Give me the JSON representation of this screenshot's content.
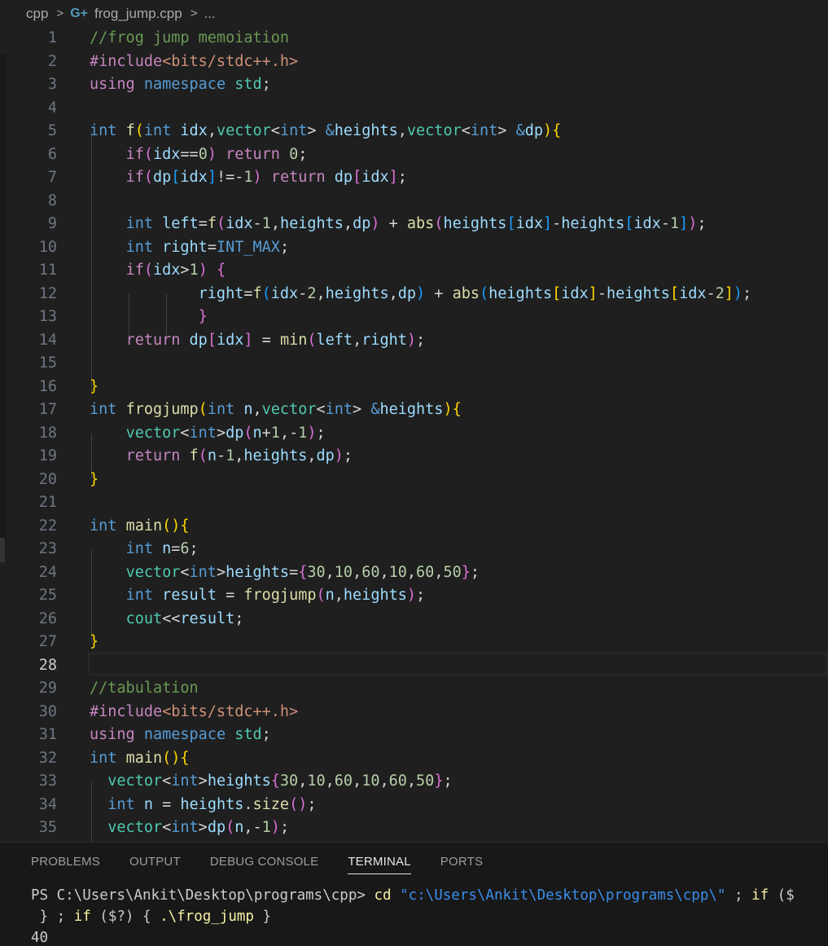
{
  "breadcrumb": {
    "folder": "cpp",
    "file": "frog_jump.cpp",
    "more": "..."
  },
  "editor": {
    "active_line": "28",
    "lines": [
      {
        "n": "1",
        "html": "<span class='cm'>//frog jump memoiation</span>"
      },
      {
        "n": "2",
        "html": "<span class='c'>#include</span><span class='s'>&lt;bits/stdc++.h&gt;</span>"
      },
      {
        "n": "3",
        "html": "<span class='c'>using</span> <span class='k'>namespace</span> <span class='t'>std</span><span class='p'>;</span>"
      },
      {
        "n": "4",
        "html": ""
      },
      {
        "n": "5",
        "html": "<span class='k'>int</span> <span class='f'>f</span><span class='b1'>(</span><span class='k'>int</span> <span class='v'>idx</span><span class='p'>,</span><span class='t'>vector</span><span class='p'>&lt;</span><span class='k'>int</span><span class='p'>&gt;</span> <span class='k'>&amp;</span><span class='v'>heights</span><span class='p'>,</span><span class='t'>vector</span><span class='p'>&lt;</span><span class='k'>int</span><span class='p'>&gt;</span> <span class='k'>&amp;</span><span class='v'>dp</span><span class='b1'>)</span><span class='b1'>{</span>"
      },
      {
        "n": "6",
        "html": "    <span class='c'>if</span><span class='b2'>(</span><span class='v'>idx</span><span class='p'>==</span><span class='n'>0</span><span class='b2'>)</span> <span class='c'>return</span> <span class='n'>0</span><span class='p'>;</span>"
      },
      {
        "n": "7",
        "html": "    <span class='c'>if</span><span class='b2'>(</span><span class='v'>dp</span><span class='b3'>[</span><span class='v'>idx</span><span class='b3'>]</span><span class='p'>!=-</span><span class='n'>1</span><span class='b2'>)</span> <span class='c'>return</span> <span class='v'>dp</span><span class='b2'>[</span><span class='v'>idx</span><span class='b2'>]</span><span class='p'>;</span>"
      },
      {
        "n": "8",
        "html": ""
      },
      {
        "n": "9",
        "html": "    <span class='k'>int</span> <span class='v'>left</span><span class='p'>=</span><span class='f'>f</span><span class='b2'>(</span><span class='v'>idx</span><span class='p'>-</span><span class='n'>1</span><span class='p'>,</span><span class='v'>heights</span><span class='p'>,</span><span class='v'>dp</span><span class='b2'>)</span> <span class='p'>+</span> <span class='f'>abs</span><span class='b2'>(</span><span class='v'>heights</span><span class='b3'>[</span><span class='v'>idx</span><span class='b3'>]</span><span class='p'>-</span><span class='v'>heights</span><span class='b3'>[</span><span class='v'>idx</span><span class='p'>-</span><span class='n'>1</span><span class='b3'>]</span><span class='b2'>)</span><span class='p'>;</span>"
      },
      {
        "n": "10",
        "html": "    <span class='k'>int</span> <span class='v'>right</span><span class='p'>=</span><span class='k'>INT_MAX</span><span class='p'>;</span>"
      },
      {
        "n": "11",
        "html": "    <span class='c'>if</span><span class='b2'>(</span><span class='v'>idx</span><span class='p'>&gt;</span><span class='n'>1</span><span class='b2'>)</span> <span class='b2'>{</span>"
      },
      {
        "n": "12",
        "html": "            <span class='v'>right</span><span class='p'>=</span><span class='f'>f</span><span class='b3'>(</span><span class='v'>idx</span><span class='p'>-</span><span class='n'>2</span><span class='p'>,</span><span class='v'>heights</span><span class='p'>,</span><span class='v'>dp</span><span class='b3'>)</span> <span class='p'>+</span> <span class='f'>abs</span><span class='b3'>(</span><span class='v'>heights</span><span class='b1'>[</span><span class='v'>idx</span><span class='b1'>]</span><span class='p'>-</span><span class='v'>heights</span><span class='b1'>[</span><span class='v'>idx</span><span class='p'>-</span><span class='n'>2</span><span class='b1'>]</span><span class='b3'>)</span><span class='p'>;</span>"
      },
      {
        "n": "13",
        "html": "            <span class='b2'>}</span>"
      },
      {
        "n": "14",
        "html": "    <span class='c'>return</span> <span class='v'>dp</span><span class='b2'>[</span><span class='v'>idx</span><span class='b2'>]</span> <span class='p'>=</span> <span class='f'>min</span><span class='b2'>(</span><span class='v'>left</span><span class='p'>,</span><span class='v'>right</span><span class='b2'>)</span><span class='p'>;</span>"
      },
      {
        "n": "15",
        "html": ""
      },
      {
        "n": "16",
        "html": "<span class='b1'>}</span>"
      },
      {
        "n": "17",
        "html": "<span class='k'>int</span> <span class='f'>frogjump</span><span class='b1'>(</span><span class='k'>int</span> <span class='v'>n</span><span class='p'>,</span><span class='t'>vector</span><span class='p'>&lt;</span><span class='k'>int</span><span class='p'>&gt;</span> <span class='k'>&amp;</span><span class='v'>heights</span><span class='b1'>)</span><span class='b1'>{</span>"
      },
      {
        "n": "18",
        "html": "    <span class='t'>vector</span><span class='p'>&lt;</span><span class='k'>int</span><span class='p'>&gt;</span><span class='v'>dp</span><span class='b2'>(</span><span class='v'>n</span><span class='p'>+</span><span class='n'>1</span><span class='p'>,-</span><span class='n'>1</span><span class='b2'>)</span><span class='p'>;</span>"
      },
      {
        "n": "19",
        "html": "    <span class='c'>return</span> <span class='f'>f</span><span class='b2'>(</span><span class='v'>n</span><span class='p'>-</span><span class='n'>1</span><span class='p'>,</span><span class='v'>heights</span><span class='p'>,</span><span class='v'>dp</span><span class='b2'>)</span><span class='p'>;</span>"
      },
      {
        "n": "20",
        "html": "<span class='b1'>}</span>"
      },
      {
        "n": "21",
        "html": ""
      },
      {
        "n": "22",
        "html": "<span class='k'>int</span> <span class='f'>main</span><span class='b1'>()</span><span class='b1'>{</span>"
      },
      {
        "n": "23",
        "html": "    <span class='k'>int</span> <span class='v'>n</span><span class='p'>=</span><span class='n'>6</span><span class='p'>;</span>"
      },
      {
        "n": "24",
        "html": "    <span class='t'>vector</span><span class='p'>&lt;</span><span class='k'>int</span><span class='p'>&gt;</span><span class='v'>heights</span><span class='p'>=</span><span class='b2'>{</span><span class='n'>30</span><span class='p'>,</span><span class='n'>10</span><span class='p'>,</span><span class='n'>60</span><span class='p'>,</span><span class='n'>10</span><span class='p'>,</span><span class='n'>60</span><span class='p'>,</span><span class='n'>50</span><span class='b2'>}</span><span class='p'>;</span>"
      },
      {
        "n": "25",
        "html": "    <span class='k'>int</span> <span class='v'>result</span> <span class='p'>=</span> <span class='f'>frogjump</span><span class='b2'>(</span><span class='v'>n</span><span class='p'>,</span><span class='v'>heights</span><span class='b2'>)</span><span class='p'>;</span>"
      },
      {
        "n": "26",
        "html": "    <span class='t'>cout</span><span class='p'>&lt;&lt;</span><span class='v'>result</span><span class='p'>;</span>"
      },
      {
        "n": "27",
        "html": "<span class='b1'>}</span>"
      },
      {
        "n": "28",
        "html": ""
      },
      {
        "n": "29",
        "html": "<span class='cm'>//tabulation</span>"
      },
      {
        "n": "30",
        "html": "<span class='c'>#include</span><span class='s'>&lt;bits/stdc++.h&gt;</span>"
      },
      {
        "n": "31",
        "html": "<span class='c'>using</span> <span class='k'>namespace</span> <span class='t'>std</span><span class='p'>;</span>"
      },
      {
        "n": "32",
        "html": "<span class='k'>int</span> <span class='f'>main</span><span class='b1'>()</span><span class='b1'>{</span>"
      },
      {
        "n": "33",
        "html": "  <span class='t'>vector</span><span class='p'>&lt;</span><span class='k'>int</span><span class='p'>&gt;</span><span class='v'>heights</span><span class='b2'>{</span><span class='n'>30</span><span class='p'>,</span><span class='n'>10</span><span class='p'>,</span><span class='n'>60</span><span class='p'>,</span><span class='n'>10</span><span class='p'>,</span><span class='n'>60</span><span class='p'>,</span><span class='n'>50</span><span class='b2'>}</span><span class='p'>;</span>"
      },
      {
        "n": "34",
        "html": "  <span class='k'>int</span> <span class='v'>n</span> <span class='p'>=</span> <span class='v'>heights</span><span class='p'>.</span><span class='f'>size</span><span class='b2'>()</span><span class='p'>;</span>"
      },
      {
        "n": "35",
        "html": "  <span class='t'>vector</span><span class='p'>&lt;</span><span class='k'>int</span><span class='p'>&gt;</span><span class='v'>dp</span><span class='b2'>(</span><span class='v'>n</span><span class='p'>,-</span><span class='n'>1</span><span class='b2'>)</span><span class='p'>;</span>"
      }
    ]
  },
  "panel": {
    "tabs": [
      "PROBLEMS",
      "OUTPUT",
      "DEBUG CONSOLE",
      "TERMINAL",
      "PORTS"
    ],
    "active_tab": "TERMINAL",
    "terminal": {
      "prompt": "PS C:\\Users\\Ankit\\Desktop\\programs\\cpp> ",
      "cmd": "cd",
      "path": "\"c:\\Users\\Ankit\\Desktop\\programs\\cpp\\\"",
      "rest1": " ; ",
      "if_kw": "if",
      "tail1": " ($",
      "line2_a": " } ; ",
      "line2_if": "if",
      "line2_b": " ($?) { ",
      "line2_run": ".\\frog_jump",
      "line2_c": " }",
      "output": "40"
    }
  },
  "colors": {
    "background": "#1f1f1f",
    "panel": "#181818",
    "keyword": "#569cd6",
    "control": "#c586c0",
    "function": "#dcdcaa",
    "variable": "#9cdcfe",
    "type": "#4ec9b0",
    "number": "#b5cea8",
    "string": "#ce9178",
    "comment": "#6a9955"
  }
}
